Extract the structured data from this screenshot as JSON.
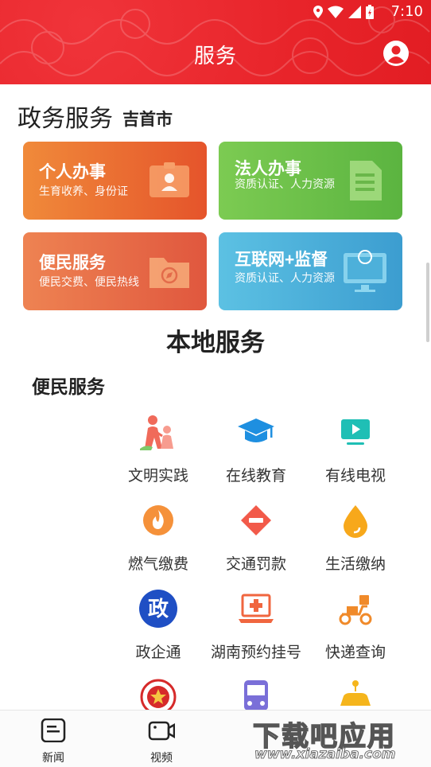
{
  "status_bar": {
    "time": "7:10"
  },
  "header": {
    "title": "服务"
  },
  "gov": {
    "title": "政务服务",
    "city": "吉首市"
  },
  "cards": [
    {
      "title": "个人办事",
      "subtitle": "生育收养、身份证",
      "icon": "id-card-icon"
    },
    {
      "title": "法人办事",
      "subtitle": "资质认证、人力资源",
      "icon": "document-icon"
    },
    {
      "title": "便民服务",
      "subtitle": "便民交费、便民热线",
      "icon": "folder-compass-icon"
    },
    {
      "title": "互联网+监督",
      "subtitle": "资质认证、人力资源",
      "icon": "monitor-icon"
    }
  ],
  "local": {
    "title": "本地服务",
    "section": "便民服务"
  },
  "services": [
    {
      "label": "文明实践",
      "icon": "volunteer-icon"
    },
    {
      "label": "在线教育",
      "icon": "graduation-cap-icon"
    },
    {
      "label": "有线电视",
      "icon": "tv-icon"
    },
    {
      "label": "燃气缴费",
      "icon": "flame-icon"
    },
    {
      "label": "交通罚款",
      "icon": "no-entry-icon"
    },
    {
      "label": "生活缴纳",
      "icon": "water-drop-icon"
    },
    {
      "label": "政企通",
      "icon": "zheng-badge-icon",
      "glyph": "政"
    },
    {
      "label": "湖南预约挂号",
      "icon": "hospital-laptop-icon"
    },
    {
      "label": "快递查询",
      "icon": "delivery-scooter-icon"
    },
    {
      "label": "",
      "icon": "police-emblem-icon"
    },
    {
      "label": "",
      "icon": "bus-icon"
    },
    {
      "label": "",
      "icon": "taxi-icon"
    }
  ],
  "bottom_nav": [
    {
      "label": "新闻",
      "icon": "news-icon"
    },
    {
      "label": "视频",
      "icon": "video-icon"
    }
  ],
  "watermark": {
    "line1": "下载吧应用",
    "line2": "www.xiazaiba.com"
  }
}
